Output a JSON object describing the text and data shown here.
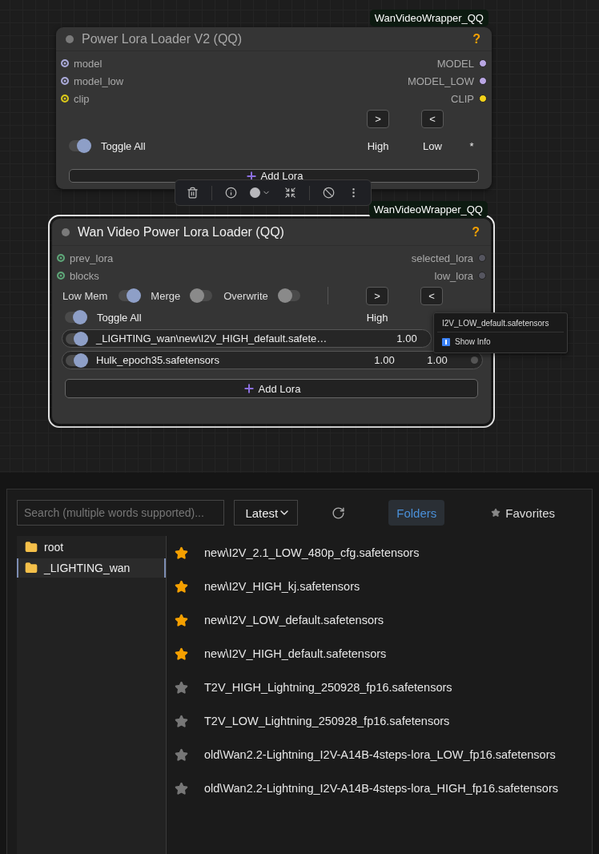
{
  "canvas": {
    "nodes": [
      {
        "kind": "power_lora",
        "badge": "WanVideoWrapper_QQ",
        "title": "Power Lora Loader V2 (QQ)",
        "selected": false,
        "help": "?",
        "inputs": [
          {
            "name": "model",
            "color": "#a9a9d9"
          },
          {
            "name": "model_low",
            "color": "#a9a9d9"
          },
          {
            "name": "clip",
            "color": "#d9c71a"
          }
        ],
        "outputs": [
          {
            "name": "MODEL",
            "color": "#b9a6e3"
          },
          {
            "name": "MODEL_LOW",
            "color": "#b9a6e3"
          },
          {
            "name": "CLIP",
            "color": "#f2d21b"
          }
        ],
        "move_buttons": [
          ">",
          "<"
        ],
        "toggle_all": {
          "label": "Toggle All",
          "on": true
        },
        "columns": [
          "High",
          "Low",
          "*"
        ],
        "add_button": "Add Lora"
      },
      {
        "kind": "wan_lora",
        "badge": "WanVideoWrapper_QQ",
        "title": "Wan Video Power Lora Loader (QQ)",
        "selected": true,
        "help": "?",
        "inputs": [
          {
            "name": "prev_lora",
            "color": "#5ea678"
          },
          {
            "name": "blocks",
            "color": "#5ea678"
          }
        ],
        "outputs": [
          {
            "name": "selected_lora",
            "color": "#55555f"
          },
          {
            "name": "low_lora",
            "color": "#55555f"
          }
        ],
        "options": [
          {
            "label": "Low Mem",
            "on": true
          },
          {
            "label": "Merge",
            "on": false
          },
          {
            "label": "Overwrite",
            "on": false
          }
        ],
        "move_buttons": [
          ">",
          "<"
        ],
        "toggle_all": {
          "label": "Toggle All",
          "on": true
        },
        "columns": [
          "High"
        ],
        "loras": [
          {
            "name": "_LIGHTING_wan\\new\\I2V_HIGH_default.safete…",
            "on": true,
            "high": "1.00"
          },
          {
            "name": "Hulk_epoch35.safetensors",
            "on": true,
            "high": "1.00",
            "low": "1.00"
          }
        ],
        "add_button": "Add Lora"
      }
    ],
    "context_menu": {
      "title": "I2V_LOW_default.safetensors",
      "items": [
        {
          "label": "Show Info"
        }
      ]
    }
  },
  "browser": {
    "search": {
      "placeholder": "Search (multiple words supported)..."
    },
    "sort": "Latest",
    "tabs": [
      {
        "label": "Folders",
        "selected": true
      },
      {
        "label": "Favorites",
        "selected": false
      }
    ],
    "folders": [
      {
        "name": "root",
        "selected": false
      },
      {
        "name": "_LIGHTING_wan",
        "selected": true
      }
    ],
    "files": [
      {
        "name": "new\\I2V_2.1_LOW_480p_cfg.safetensors",
        "favorite": true
      },
      {
        "name": "new\\I2V_HIGH_kj.safetensors",
        "favorite": true
      },
      {
        "name": "new\\I2V_LOW_default.safetensors",
        "favorite": true
      },
      {
        "name": "new\\I2V_HIGH_default.safetensors",
        "favorite": true
      },
      {
        "name": "T2V_HIGH_Lightning_250928_fp16.safetensors",
        "favorite": false
      },
      {
        "name": "T2V_LOW_Lightning_250928_fp16.safetensors",
        "favorite": false
      },
      {
        "name": "old\\Wan2.2-Lightning_I2V-A14B-4steps-lora_LOW_fp16.safetensors",
        "favorite": false
      },
      {
        "name": "old\\Wan2.2-Lightning_I2V-A14B-4steps-lora_HIGH_fp16.safetensors",
        "favorite": false
      }
    ]
  }
}
